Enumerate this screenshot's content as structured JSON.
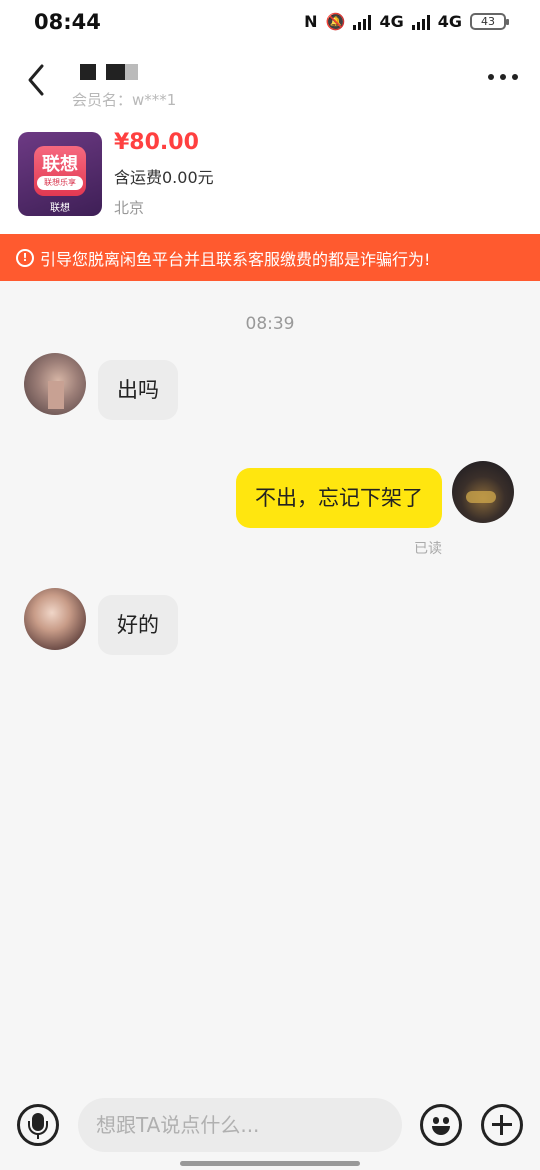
{
  "status_bar": {
    "time": "08:44",
    "network_1": "4G",
    "network_2": "4G",
    "battery": "43"
  },
  "header": {
    "member_label": "会员名：w***1"
  },
  "product": {
    "price": "¥80.00",
    "shipping": "含运费0.00元",
    "location": "北京",
    "image_text": "联想",
    "image_pill": "联想乐享",
    "image_caption": "联想"
  },
  "warning": {
    "text": "引导您脱离闲鱼平台并且联系客服缴费的都是诈骗行为!"
  },
  "chat": {
    "timestamp": "08:39",
    "messages": [
      {
        "side": "left",
        "text": "出吗"
      },
      {
        "side": "right",
        "text": "不出，忘记下架了",
        "status": "已读"
      },
      {
        "side": "left",
        "text": "好的"
      }
    ]
  },
  "input": {
    "placeholder": "想跟TA说点什么..."
  },
  "colors": {
    "accent_red": "#ff4040",
    "warning_bg": "#ff5a2f",
    "my_bubble": "#ffe60f",
    "other_bubble": "#ececec"
  },
  "icons": [
    "back-icon",
    "more-icon",
    "warning-icon",
    "microphone-icon",
    "emoji-icon",
    "plus-icon"
  ]
}
